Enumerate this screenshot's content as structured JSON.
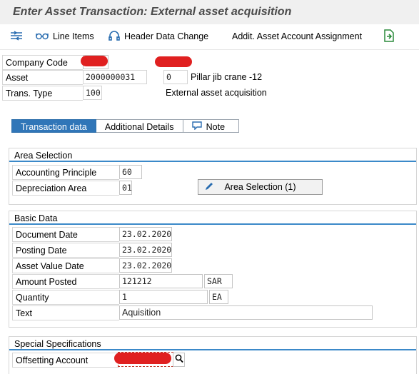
{
  "window": {
    "title": "Enter Asset Transaction: External asset acquisition"
  },
  "toolbar": {
    "items": [
      {
        "label": "",
        "icon": "expand-collapse-icon"
      },
      {
        "label": "Line Items",
        "icon": "glasses-icon"
      },
      {
        "label": "Header Data Change",
        "icon": "headset-icon"
      },
      {
        "label": "Addit. Asset Account Assignment",
        "icon": ""
      },
      {
        "label": "",
        "icon": "export-icon"
      }
    ]
  },
  "header": {
    "company_code": {
      "label": "Company Code",
      "value": ""
    },
    "asset": {
      "label": "Asset",
      "value": "2000000031",
      "sub_number": "0",
      "description": "Pillar jib crane -12"
    },
    "trans_type": {
      "label": "Trans. Type",
      "value": "100",
      "description": "External asset acquisition"
    }
  },
  "tabs": [
    {
      "label": "Transaction data",
      "active": true
    },
    {
      "label": "Additional Details",
      "active": false
    },
    {
      "label": "Note",
      "active": false,
      "icon": "note-icon"
    }
  ],
  "area_selection": {
    "title": "Area Selection",
    "accounting_principle": {
      "label": "Accounting Principle",
      "value": "60"
    },
    "depreciation_area": {
      "label": "Depreciation Area",
      "value": "01"
    },
    "button_label": "Area Selection (1)"
  },
  "basic_data": {
    "title": "Basic Data",
    "document_date": {
      "label": "Document Date",
      "value": "23.02.2020"
    },
    "posting_date": {
      "label": "Posting Date",
      "value": "23.02.2020"
    },
    "asset_value_date": {
      "label": "Asset Value Date",
      "value": "23.02.2020"
    },
    "amount_posted": {
      "label": "Amount Posted",
      "value": "121212",
      "currency": "SAR"
    },
    "quantity": {
      "label": "Quantity",
      "value": "1",
      "unit": "EA"
    },
    "text": {
      "label": "Text",
      "value": "Aquisition"
    }
  },
  "special_specs": {
    "title": "Special Specifications",
    "offsetting_account": {
      "label": "Offsetting Account",
      "value": ""
    }
  },
  "colors": {
    "accent": "#3076b8",
    "redaction": "#e02020"
  }
}
